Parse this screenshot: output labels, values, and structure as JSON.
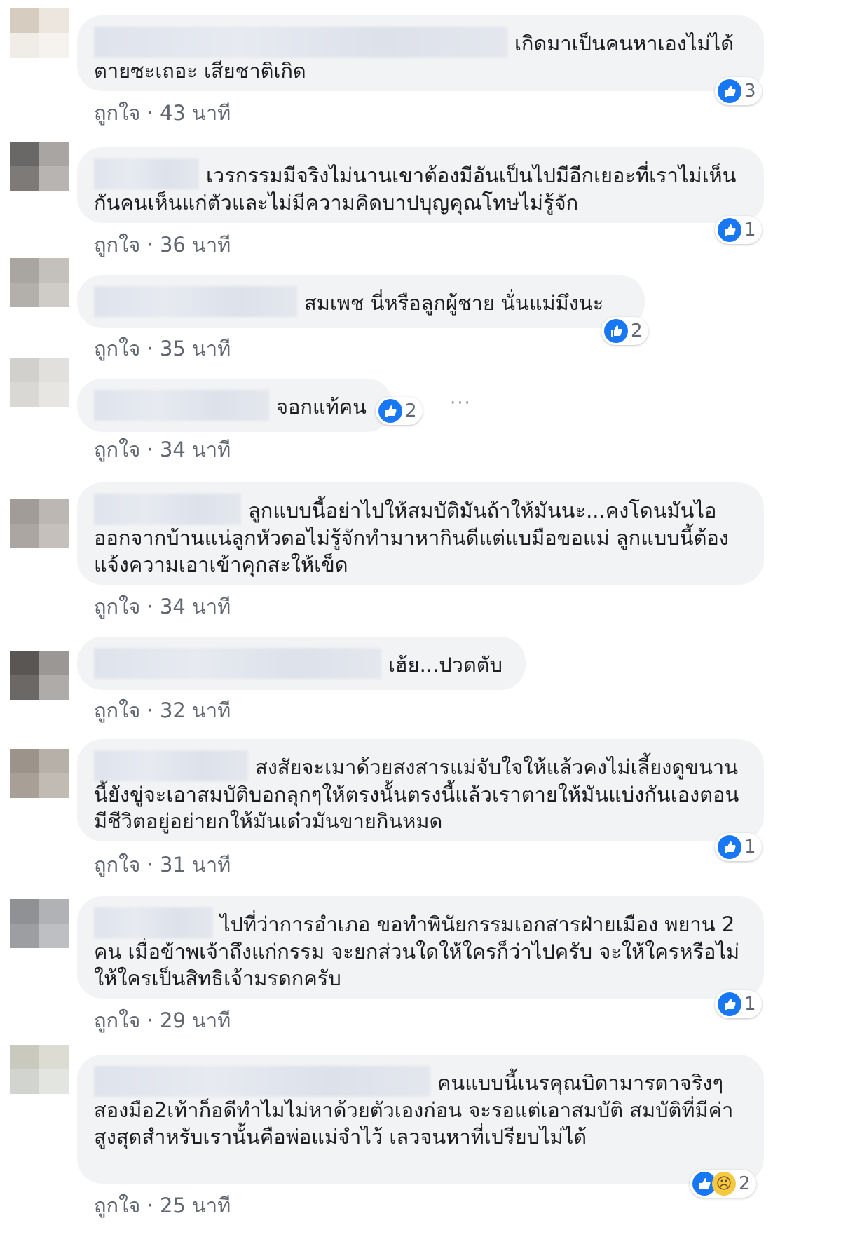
{
  "colors": {
    "bubble_bg": "#f2f3f5",
    "like_blue": "#1877f2",
    "meta_text": "#606770",
    "sad_yellow": "#f7c843"
  },
  "comments": [
    {
      "text": "เกิดมาเป็นคนหาเองไม่ได้ตายซะเถอะ เสียชาติเกิด",
      "reaction_count": "3",
      "like_label": "ถูกใจ",
      "separator": "·",
      "time": "43 นาที"
    },
    {
      "text": "เวรกรรมมีจริงไม่นานเขาต้องมีอันเป็นไปมีอีกเยอะที่เราไม่เห็นกันคนเห็นแก่ตัวและไม่มีความคิดบาปบุญคุณโทษไม่รู้จัก",
      "reaction_count": "1",
      "like_label": "ถูกใจ",
      "separator": "·",
      "time": "36 นาที"
    },
    {
      "text": "สมเพช นี่หรือลูกผู้ชาย นั่นแม่มึงนะ",
      "reaction_count": "2",
      "like_label": "ถูกใจ",
      "separator": "·",
      "time": "35 นาที"
    },
    {
      "text": "จอกแท้คน",
      "reaction_count": "2",
      "like_label": "ถูกใจ",
      "separator": "·",
      "time": "34 นาที",
      "more": "···"
    },
    {
      "text": "ลูกแบบนี้อย่าไปให้สมบัติมันถ้าให้มันนะ...คงโดนมันไอออกจากบ้านแน่ลูกหัวดอไม่รู้จักทำมาหากินดีแต่แบมือขอแม่ ลูกแบบนี้ต้องแจ้งความเอาเข้าคุกสะให้เข็ด",
      "like_label": "ถูกใจ",
      "separator": "·",
      "time": "34 นาที"
    },
    {
      "text": "เฮ้ย...ปวดตับ",
      "like_label": "ถูกใจ",
      "separator": "·",
      "time": "32 นาที"
    },
    {
      "text": "สงสัยจะเมาด้วยสงสารแม่จับใจให้แล้วคงไม่เลี้ยงดูขนานนี้ยังขู่จะเอาสมบัติบอกลุกๆให้ตรงนั้นตรงนี้แล้วเราตายให้มันแบ่งกันเองตอนมีชีวิตอยู่อย่ายกให้มันเด๋วมันขายกินหมด",
      "reaction_count": "1",
      "like_label": "ถูกใจ",
      "separator": "·",
      "time": "31 นาที"
    },
    {
      "text": "ไปที่ว่าการอำเภอ ขอทำพินัยกรรมเอกสารฝ่ายเมือง พยาน 2 คน เมื่อข้าพเจ้าถึงแก่กรรม จะยกส่วนใดให้ใครก็ว่าไปครับ จะให้ใครหรือไม่ให้ใครเป็นสิทธิเจ้ามรดกครับ",
      "reaction_count": "1",
      "like_label": "ถูกใจ",
      "separator": "·",
      "time": "29 นาที"
    },
    {
      "text": "คนแบบนี้เนรคุณบิดามารดาจริงๆ สองมือ2เท้าก็อดีทำไมไม่หาด้วยตัวเองก่อน จะรอแต่เอาสมบัติ สมบัติที่มีค่าสูงสุดสำหรับเรานั้นคือพ่อแม่จำไว้ เลวจนหาที่เปรียบไม่ได้",
      "reaction_count": "2",
      "like_label": "ถูกใจ",
      "separator": "·",
      "time": "25 นาที"
    }
  ]
}
